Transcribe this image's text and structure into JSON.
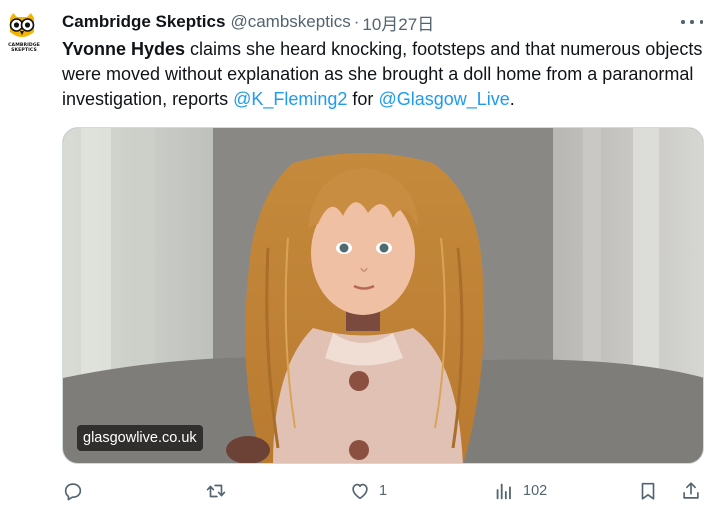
{
  "author": {
    "display_name": "Cambridge Skeptics",
    "handle": "@cambskeptics",
    "separator": "·",
    "timestamp": "10月27日",
    "avatar_label_line1": "CAMBRIDGE",
    "avatar_label_line2": "SKEPTICS"
  },
  "tweet": {
    "name_bold": "Yvonne Hydes",
    "text_part1": " claims she heard knocking, footsteps and that numerous objects were moved without explanation as she brought a doll home from a paranormal investigation, reports ",
    "mention1": "@K_Fleming2",
    "text_part2": " for ",
    "mention2": "@Glasgow_Live",
    "text_part3": "."
  },
  "media": {
    "source_badge": "glasgowlive.co.uk",
    "alt_subject": "doll-photo"
  },
  "actions": {
    "reply_count": "",
    "retweet_count": "",
    "like_count": "1",
    "views_count": "102"
  },
  "colors": {
    "link": "#1d9bf0",
    "text_primary": "#0f1419",
    "text_secondary": "#536471",
    "avatar_yellow": "#f5b400"
  },
  "icons": [
    "owl-logo-icon",
    "more-dots-icon",
    "reply-icon",
    "retweet-icon",
    "like-icon",
    "views-icon",
    "bookmark-icon",
    "share-icon"
  ]
}
